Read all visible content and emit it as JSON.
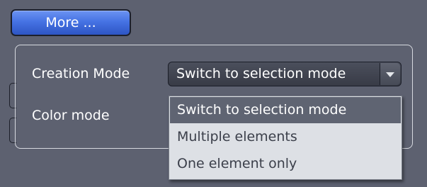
{
  "more_button": {
    "label": "More ..."
  },
  "form": {
    "creation_mode_label": "Creation Mode",
    "color_mode_label": "Color mode",
    "creation_mode_value": "Switch to selection mode"
  },
  "dropdown": {
    "options": [
      {
        "label": "Switch to selection mode",
        "selected": true
      },
      {
        "label": "Multiple elements",
        "selected": false
      },
      {
        "label": "One element only",
        "selected": false
      }
    ]
  },
  "colors": {
    "background": "#5d6170",
    "button_blue": "#4673e4",
    "dropdown_bg": "#dde0e5",
    "selection_bg": "#5f6472"
  },
  "icons": {
    "combo_arrow": "chevron-down-icon"
  }
}
